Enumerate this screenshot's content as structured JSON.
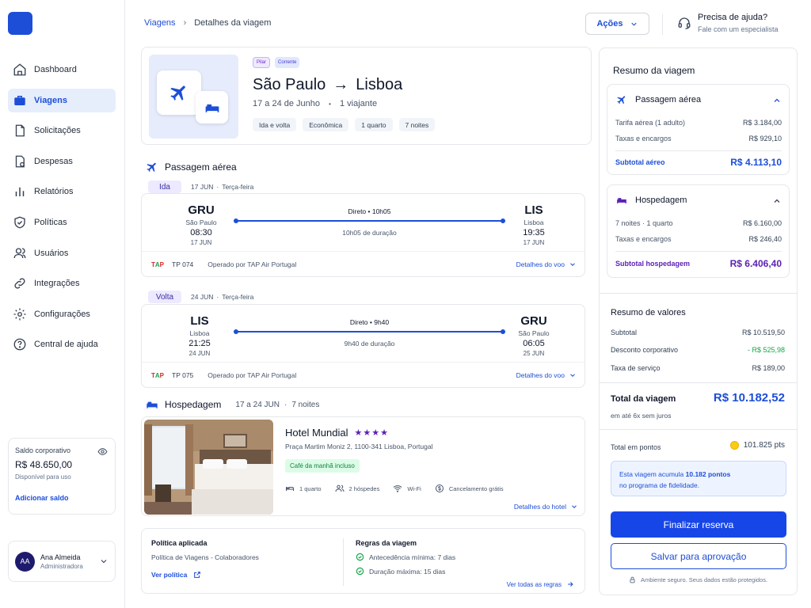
{
  "sidebar": {
    "items": [
      {
        "label": "Dashboard",
        "icon": "home-icon"
      },
      {
        "label": "Viagens",
        "icon": "briefcase-icon",
        "active": true
      },
      {
        "label": "Solicitações",
        "icon": "document-icon"
      },
      {
        "label": "Despesas",
        "icon": "receipt-icon"
      },
      {
        "label": "Relatórios",
        "icon": "bar-chart-icon"
      },
      {
        "label": "Políticas",
        "icon": "shield-check-icon"
      },
      {
        "label": "Usuários",
        "icon": "users-icon"
      },
      {
        "label": "Integrações",
        "icon": "link-icon"
      },
      {
        "label": "Configurações",
        "icon": "gear-icon"
      },
      {
        "label": "Central de ajuda",
        "icon": "help-circle-icon"
      }
    ],
    "balance": {
      "label": "Saldo corporativo",
      "amount": "R$ 48.650,00",
      "sub": "Disponível para uso",
      "link": "Adicionar saldo"
    },
    "user": {
      "initials": "AA",
      "name": "Ana Almeida",
      "role": "Administradora"
    }
  },
  "header": {
    "breadcrumb": [
      "Viagens",
      "Detalhes da viagem"
    ],
    "actions_label": "Ações",
    "help_title": "Precisa de ajuda?",
    "help_sub": "Fale com um especialista"
  },
  "trip": {
    "tags": [
      "Pilar",
      "Corrente"
    ],
    "origin": "São Paulo",
    "arrow": "→",
    "destination": "Lisboa",
    "dates": "17 a 24 de Junho",
    "dot": "•",
    "travelers": "1 viajante",
    "chips": [
      "Ida e volta",
      "Econômica",
      "1 quarto",
      "7 noites"
    ]
  },
  "flights": {
    "title": "Passagem aérea",
    "legs": [
      {
        "badge": "Ida",
        "date": "17 JUN",
        "weekday": "Terça-feira",
        "from_code": "GRU",
        "from_city": "São Paulo",
        "from_time": "08:30",
        "from_day": "17 JUN",
        "to_code": "LIS",
        "to_city": "Lisboa",
        "to_time": "19:35",
        "to_day": "17 JUN",
        "direct": "Direto • 10h05",
        "duration": "10h05 de duração",
        "airline": "TAP",
        "flight_no": "TP 074",
        "operated": "Operado por TAP Air Portugal",
        "details": "Detalhes do voo"
      },
      {
        "badge": "Volta",
        "date": "24 JUN",
        "weekday": "Terça-feira",
        "from_code": "LIS",
        "from_city": "Lisboa",
        "from_time": "21:25",
        "from_day": "24 JUN",
        "to_code": "GRU",
        "to_city": "São Paulo",
        "to_time": "06:05",
        "to_day": "25 JUN",
        "direct": "Direto • 9h40",
        "duration": "9h40 de duração",
        "airline": "TAP",
        "flight_no": "TP 075",
        "operated": "Operado por TAP Air Portugal",
        "details": "Detalhes do voo"
      }
    ]
  },
  "hotel": {
    "section_title": "Hospedagem",
    "dates": "17 a 24 JUN",
    "nights": "7 noites",
    "name": "Hotel Mundial",
    "stars": "★★★★",
    "address": "Praça Martim Moniz 2, 1100-341 Lisboa, Portugal",
    "breakfast": "Café da manhã incluso",
    "amenities": [
      "1 quarto",
      "2 hóspedes",
      "Wi-Fi",
      "Cancelamento grátis"
    ],
    "details": "Detalhes do hotel"
  },
  "policy": {
    "title": "Política aplicada",
    "name": "Política de Viagens - Colaboradores",
    "link": "Ver política",
    "rules_title": "Regras da viagem",
    "rules": [
      "Antecedência mínima: 7 dias",
      "Duração máxima: 15 dias"
    ],
    "rules_link": "Ver todas as regras"
  },
  "summary": {
    "title": "Resumo da viagem",
    "air": {
      "title": "Passagem aérea",
      "rows": [
        {
          "k": "Tarifa aérea (1 adulto)",
          "v": "R$ 3.184,00"
        },
        {
          "k": "Taxas e encargos",
          "v": "R$ 929,10"
        }
      ],
      "subtotal_k": "Subtotal aéreo",
      "subtotal_v": "R$ 4.113,10"
    },
    "hotel": {
      "title": "Hospedagem",
      "rows": [
        {
          "k": "7 noites · 1 quarto",
          "v": "R$ 6.160,00"
        },
        {
          "k": "Taxas e encargos",
          "v": "R$ 246,40"
        }
      ],
      "subtotal_k": "Subtotal hospedagem",
      "subtotal_v": "R$ 6.406,40"
    },
    "values": {
      "title": "Resumo de valores",
      "rows": [
        {
          "k": "Subtotal",
          "v": "R$ 10.519,50"
        },
        {
          "k": "Desconto corporativo",
          "v": "- R$ 525,98"
        },
        {
          "k": "Taxa de serviço",
          "v": "R$ 189,00"
        }
      ]
    },
    "total_k": "Total da viagem",
    "total_v": "R$ 10.182,52",
    "total_sub": "em até 6x sem juros",
    "points_k": "Total em pontos",
    "points_v": "101.825 pts",
    "loyalty_pre": "Esta viagem acumula ",
    "loyalty_pts": "10.182 pontos",
    "loyalty_post": "no programa de fidelidade.",
    "finalize": "Finalizar reserva",
    "save": "Salvar para aprovação",
    "secure": "Ambiente seguro. Seus dados estão protegidos."
  },
  "colors": {
    "primary": "#1d4ed8",
    "button": "#1746e8",
    "purple": "#5b21b6",
    "success": "#16a34a"
  }
}
